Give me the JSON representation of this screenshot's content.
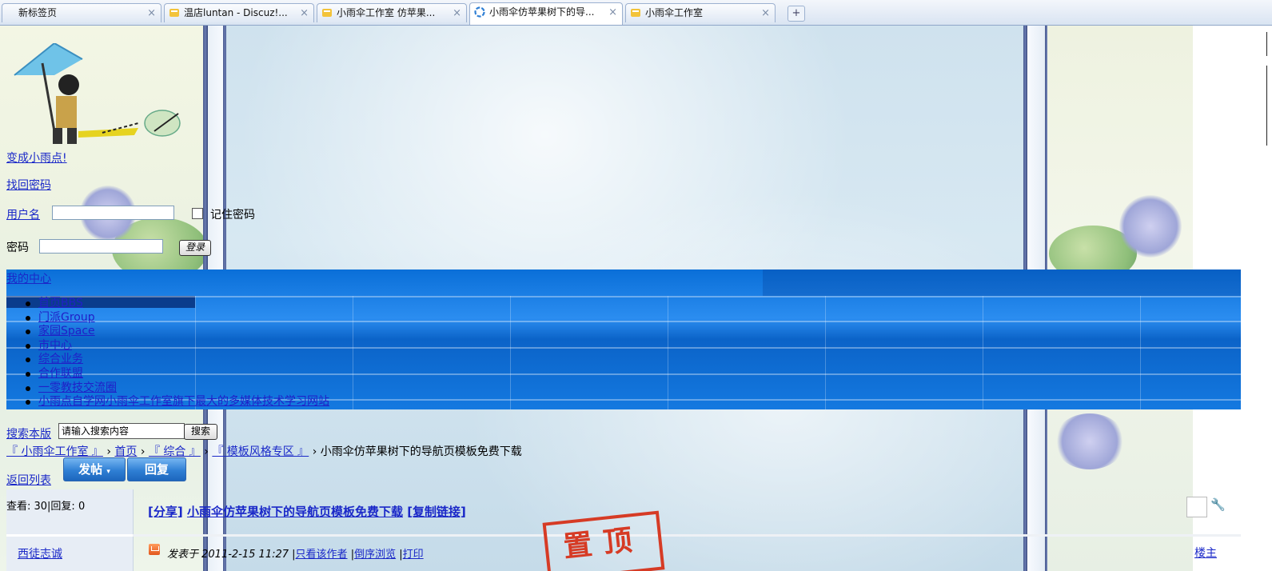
{
  "browser": {
    "tabs": [
      {
        "label": "新标签页",
        "active": false
      },
      {
        "label": "温店luntan - Discuz!...",
        "active": false
      },
      {
        "label": "小雨伞工作室 仿苹果...",
        "active": false
      },
      {
        "label": "小雨伞仿苹果树下的导...",
        "active": true
      },
      {
        "label": "小雨伞工作室",
        "active": false
      }
    ],
    "close_glyph": "×",
    "new_tab_glyph": "+"
  },
  "login": {
    "register_link": "变成小雨点!",
    "forgot_link": "找回密码",
    "username_label": "用户名",
    "remember_label": "记住密码",
    "password_label": "密码",
    "login_button": "登录",
    "my_center": "我的中心"
  },
  "nav": {
    "items": [
      "首页BBS",
      "门派Group",
      "家园Space",
      "市中心",
      "综合业务",
      "合作联盟",
      "一零教技交流圈",
      "小雨点自学网小雨伞工作室旗下最大的多媒体技术学习网站"
    ]
  },
  "search": {
    "label": "搜索本版",
    "placeholder": "请输入搜索内容",
    "button": "搜索"
  },
  "breadcrumb": {
    "items": [
      "『 小雨伞工作室 』",
      "首页",
      "『 综合 』",
      "『 模板风格专区 』"
    ],
    "separator": "›",
    "current": "小雨伞仿苹果树下的导航页模板免费下载"
  },
  "actions": {
    "back_link": "返回列表",
    "post_button": "发帖",
    "reply_button": "回复"
  },
  "thread": {
    "stats": "查看: 30|回复: 0",
    "tag": "[分享]",
    "title": "小雨伞仿苹果树下的导航页模板免费下载",
    "copy_link": "[复制链接]",
    "stamp": "置顶",
    "author": "西徒志诚",
    "posted_at": "发表于 2011-2-15 11:27",
    "only_author": "只看该作者",
    "reverse": "倒序浏览",
    "print": "打印",
    "floor": "楼主"
  },
  "colors": {
    "link": "#1a28c8",
    "nav_blue": "#0b6fd8",
    "stamp_red": "#d63b25"
  }
}
